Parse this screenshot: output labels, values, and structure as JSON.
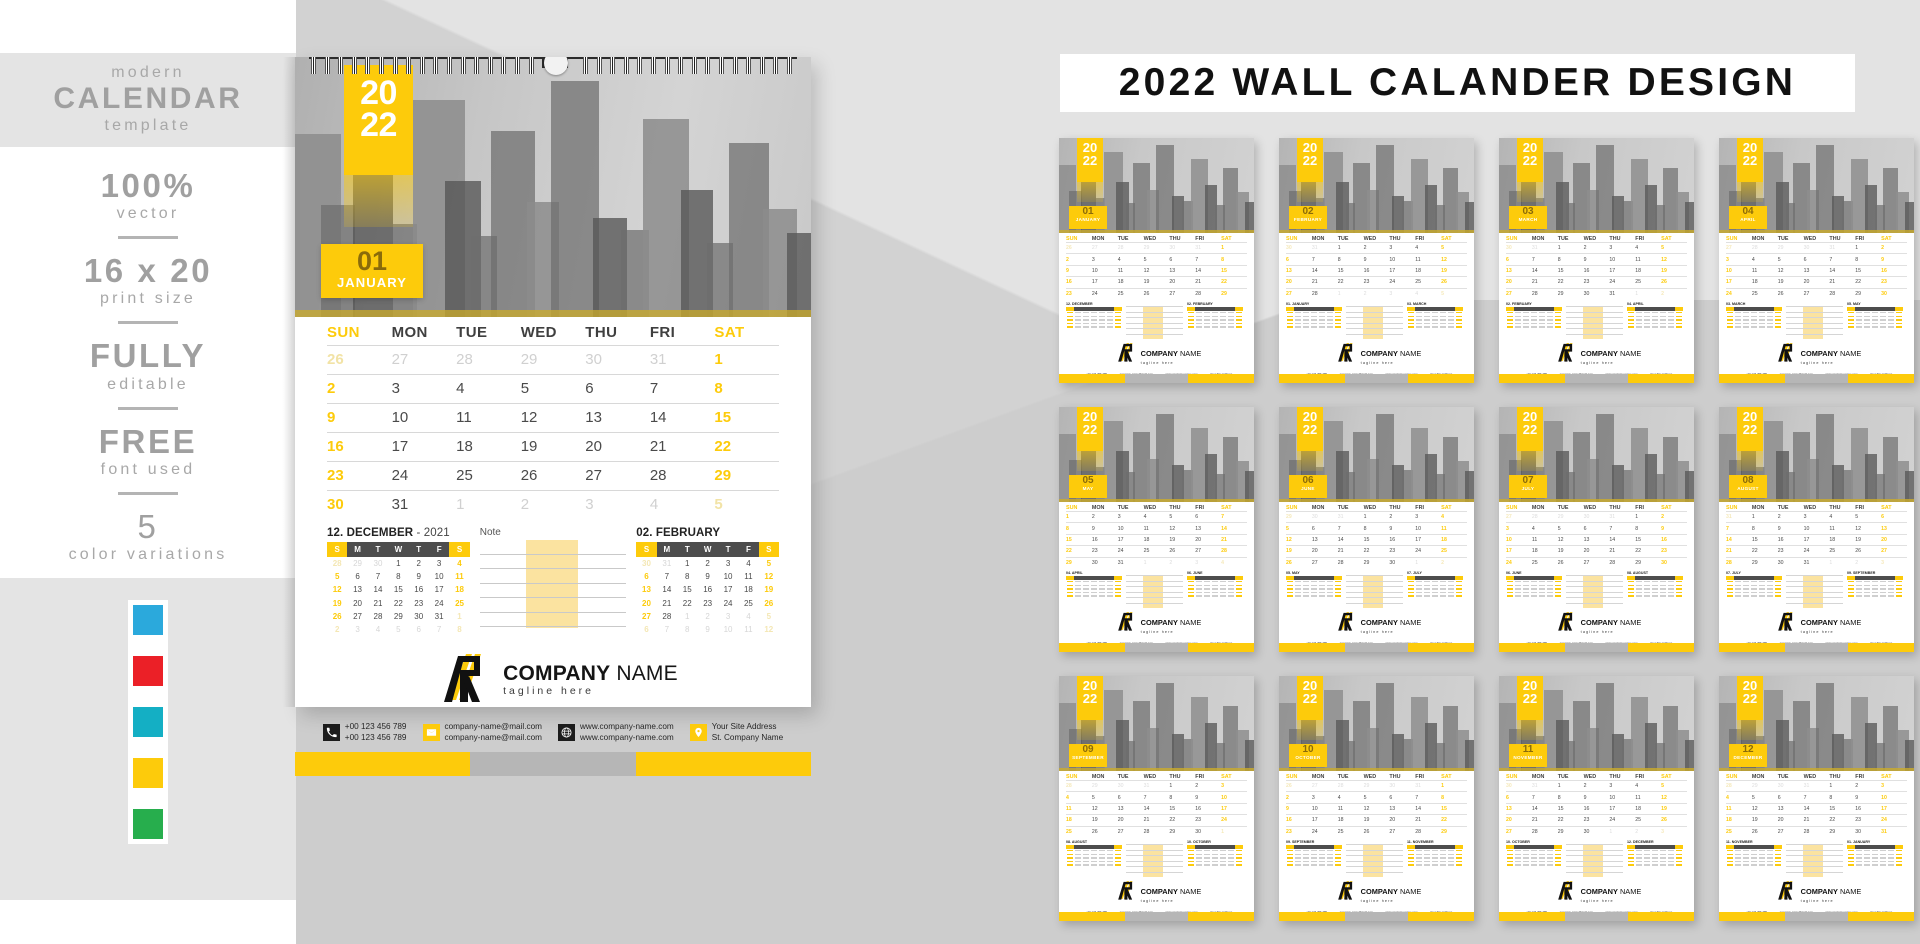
{
  "sidebar": {
    "heading_small_top": "modern",
    "heading_big": "CALENDAR",
    "heading_small_bottom": "template",
    "features": [
      {
        "big": "100%",
        "small": "vector"
      },
      {
        "big": "16 x 20",
        "small": "print size"
      },
      {
        "big": "FULLY",
        "small": "editable"
      },
      {
        "big": "FREE",
        "small": "font used"
      },
      {
        "big": "5",
        "small": "color variations"
      }
    ],
    "swatches": [
      {
        "name": "blue",
        "hex": "#2BA9DC"
      },
      {
        "name": "red",
        "hex": "#EB2027"
      },
      {
        "name": "teal",
        "hex": "#14AFC4"
      },
      {
        "name": "yellow",
        "hex": "#FDCB0B"
      },
      {
        "name": "green",
        "hex": "#27AE4D"
      }
    ]
  },
  "header": {
    "title": "2022 WALL CALANDER DESIGN"
  },
  "theme": {
    "accent": "#FDCB0B",
    "accent_dark": "#8A6B0A",
    "note_highlight": "#FBE3A0",
    "grey_dark": "#4D4D4D",
    "text": "#4A4A4A",
    "muted": "#D0D0D0"
  },
  "calendar": {
    "year": {
      "top": "20",
      "bottom": "22"
    },
    "month_number": "01",
    "month_name": "JANUARY",
    "weekdays": [
      {
        "bold": "S",
        "rest": "UN",
        "weekend": true
      },
      {
        "bold": "M",
        "rest": "ON",
        "weekend": false
      },
      {
        "bold": "T",
        "rest": "UE",
        "weekend": false
      },
      {
        "bold": "W",
        "rest": "ED",
        "weekend": false
      },
      {
        "bold": "T",
        "rest": "HU",
        "weekend": false
      },
      {
        "bold": "F",
        "rest": "RI",
        "weekend": false
      },
      {
        "bold": "S",
        "rest": "AT",
        "weekend": true
      }
    ],
    "weeks": [
      [
        {
          "d": "26",
          "mut": true,
          "sun": true
        },
        {
          "d": "27",
          "mut": true
        },
        {
          "d": "28",
          "mut": true
        },
        {
          "d": "29",
          "mut": true
        },
        {
          "d": "30",
          "mut": true
        },
        {
          "d": "31",
          "mut": true
        },
        {
          "d": "1",
          "sun": true
        }
      ],
      [
        {
          "d": "2",
          "sun": true
        },
        {
          "d": "3"
        },
        {
          "d": "4"
        },
        {
          "d": "5"
        },
        {
          "d": "6"
        },
        {
          "d": "7"
        },
        {
          "d": "8",
          "sun": true
        }
      ],
      [
        {
          "d": "9",
          "sun": true
        },
        {
          "d": "10"
        },
        {
          "d": "11"
        },
        {
          "d": "12"
        },
        {
          "d": "13"
        },
        {
          "d": "14"
        },
        {
          "d": "15",
          "sun": true
        }
      ],
      [
        {
          "d": "16",
          "sun": true
        },
        {
          "d": "17"
        },
        {
          "d": "18"
        },
        {
          "d": "19"
        },
        {
          "d": "20"
        },
        {
          "d": "21"
        },
        {
          "d": "22",
          "sun": true
        }
      ],
      [
        {
          "d": "23",
          "sun": true
        },
        {
          "d": "24"
        },
        {
          "d": "25"
        },
        {
          "d": "26"
        },
        {
          "d": "27"
        },
        {
          "d": "28"
        },
        {
          "d": "29",
          "sun": true
        }
      ],
      [
        {
          "d": "30",
          "sun": true
        },
        {
          "d": "31"
        },
        {
          "d": "1",
          "mut": true
        },
        {
          "d": "2",
          "mut": true
        },
        {
          "d": "3",
          "mut": true
        },
        {
          "d": "4",
          "mut": true
        },
        {
          "d": "5",
          "mut": true,
          "sun": true
        }
      ]
    ],
    "prev_mini": {
      "title_bold": "12. DECEMBER",
      "title_rest": " - 2021",
      "dow": [
        "S",
        "M",
        "T",
        "W",
        "T",
        "F",
        "S"
      ],
      "weeks": [
        [
          {
            "d": "28",
            "mut": true,
            "sun": true
          },
          {
            "d": "29",
            "mut": true
          },
          {
            "d": "30",
            "mut": true
          },
          {
            "d": "1"
          },
          {
            "d": "2"
          },
          {
            "d": "3"
          },
          {
            "d": "4",
            "sun": true
          }
        ],
        [
          {
            "d": "5",
            "sun": true
          },
          {
            "d": "6"
          },
          {
            "d": "7"
          },
          {
            "d": "8"
          },
          {
            "d": "9"
          },
          {
            "d": "10"
          },
          {
            "d": "11",
            "sun": true
          }
        ],
        [
          {
            "d": "12",
            "sun": true
          },
          {
            "d": "13"
          },
          {
            "d": "14"
          },
          {
            "d": "15"
          },
          {
            "d": "16"
          },
          {
            "d": "17"
          },
          {
            "d": "18",
            "sun": true
          }
        ],
        [
          {
            "d": "19",
            "sun": true
          },
          {
            "d": "20"
          },
          {
            "d": "21"
          },
          {
            "d": "22"
          },
          {
            "d": "23"
          },
          {
            "d": "24"
          },
          {
            "d": "25",
            "sun": true
          }
        ],
        [
          {
            "d": "26",
            "sun": true
          },
          {
            "d": "27"
          },
          {
            "d": "28"
          },
          {
            "d": "29"
          },
          {
            "d": "30"
          },
          {
            "d": "31"
          },
          {
            "d": "1",
            "mut": true,
            "sun": true
          }
        ],
        [
          {
            "d": "2",
            "mut": true,
            "sun": true
          },
          {
            "d": "3",
            "mut": true
          },
          {
            "d": "4",
            "mut": true
          },
          {
            "d": "5",
            "mut": true
          },
          {
            "d": "6",
            "mut": true
          },
          {
            "d": "7",
            "mut": true
          },
          {
            "d": "8",
            "mut": true,
            "sun": true
          }
        ]
      ]
    },
    "next_mini": {
      "title_bold": "02. FEBRUARY",
      "title_rest": "",
      "dow": [
        "S",
        "M",
        "T",
        "W",
        "T",
        "F",
        "S"
      ],
      "weeks": [
        [
          {
            "d": "30",
            "mut": true,
            "sun": true
          },
          {
            "d": "31",
            "mut": true
          },
          {
            "d": "1"
          },
          {
            "d": "2"
          },
          {
            "d": "3"
          },
          {
            "d": "4"
          },
          {
            "d": "5",
            "sun": true
          }
        ],
        [
          {
            "d": "6",
            "sun": true
          },
          {
            "d": "7"
          },
          {
            "d": "8"
          },
          {
            "d": "9"
          },
          {
            "d": "10"
          },
          {
            "d": "11"
          },
          {
            "d": "12",
            "sun": true
          }
        ],
        [
          {
            "d": "13",
            "sun": true
          },
          {
            "d": "14"
          },
          {
            "d": "15"
          },
          {
            "d": "16"
          },
          {
            "d": "17"
          },
          {
            "d": "18"
          },
          {
            "d": "19",
            "sun": true
          }
        ],
        [
          {
            "d": "20",
            "sun": true
          },
          {
            "d": "21"
          },
          {
            "d": "22"
          },
          {
            "d": "23"
          },
          {
            "d": "24"
          },
          {
            "d": "25"
          },
          {
            "d": "26",
            "sun": true
          }
        ],
        [
          {
            "d": "27",
            "sun": true
          },
          {
            "d": "28"
          },
          {
            "d": "1",
            "mut": true
          },
          {
            "d": "2",
            "mut": true
          },
          {
            "d": "3",
            "mut": true
          },
          {
            "d": "4",
            "mut": true
          },
          {
            "d": "5",
            "mut": true,
            "sun": true
          }
        ],
        [
          {
            "d": "6",
            "mut": true,
            "sun": true
          },
          {
            "d": "7",
            "mut": true
          },
          {
            "d": "8",
            "mut": true
          },
          {
            "d": "9",
            "mut": true
          },
          {
            "d": "10",
            "mut": true
          },
          {
            "d": "11",
            "mut": true
          },
          {
            "d": "12",
            "mut": true,
            "sun": true
          }
        ]
      ]
    },
    "note_label": "Note",
    "note_line_count": 6,
    "brand": {
      "name_bold": "COMPANY",
      "name_light": " NAME",
      "tagline": "tagline here"
    },
    "contacts": [
      {
        "icon": "phone-icon",
        "style": "dark",
        "line1": "+00 123 456 789",
        "line2": "+00 123 456 789"
      },
      {
        "icon": "mail-icon",
        "style": "yellow",
        "line1": "company-name@mail.com",
        "line2": "company-name@mail.com"
      },
      {
        "icon": "globe-icon",
        "style": "dark",
        "line1": "www.company-name.com",
        "line2": "www.company-name.com"
      },
      {
        "icon": "location-pin-icon",
        "style": "yellow",
        "line1": "Your Site Address",
        "line2": "St. Company Name"
      }
    ]
  },
  "thumbnails": [
    {
      "num": "01",
      "name": "JANUARY"
    },
    {
      "num": "02",
      "name": "FEBRUARY"
    },
    {
      "num": "03",
      "name": "MARCH"
    },
    {
      "num": "04",
      "name": "APRIL"
    },
    {
      "num": "05",
      "name": "MAY"
    },
    {
      "num": "06",
      "name": "JUNE"
    },
    {
      "num": "07",
      "name": "JULY"
    },
    {
      "num": "08",
      "name": "AUGUST"
    },
    {
      "num": "09",
      "name": "SEPTEMBER"
    },
    {
      "num": "10",
      "name": "OCTOBER"
    },
    {
      "num": "11",
      "name": "NOVEMBER"
    },
    {
      "num": "12",
      "name": "DECEMBER"
    }
  ]
}
